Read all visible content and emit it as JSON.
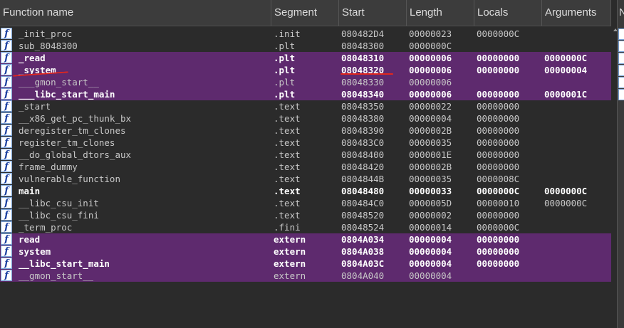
{
  "columns": [
    "Function name",
    "Segment",
    "Start",
    "Length",
    "Locals",
    "Arguments"
  ],
  "side_header": "N",
  "icon_glyph": "f",
  "highlight_color": "#5e2a6e",
  "annotation_color": "#e0261f",
  "rows": [
    {
      "name": "_init_proc",
      "segment": ".init",
      "start": "080482D4",
      "length": "00000023",
      "locals": "0000000C",
      "args": "",
      "highlight": false,
      "bold": false
    },
    {
      "name": "sub_8048300",
      "segment": ".plt",
      "start": "08048300",
      "length": "0000000C",
      "locals": "",
      "args": "",
      "highlight": false,
      "bold": false
    },
    {
      "name": "_read",
      "segment": ".plt",
      "start": "08048310",
      "length": "00000006",
      "locals": "00000000",
      "args": "0000000C",
      "highlight": true,
      "bold": true
    },
    {
      "name": "_system",
      "segment": ".plt",
      "start": "08048320",
      "length": "00000006",
      "locals": "00000000",
      "args": "00000004",
      "highlight": true,
      "bold": true
    },
    {
      "name": "___gmon_start__",
      "segment": ".plt",
      "start": "08048330",
      "length": "00000006",
      "locals": "",
      "args": "",
      "highlight": true,
      "bold": false
    },
    {
      "name": "___libc_start_main",
      "segment": ".plt",
      "start": "08048340",
      "length": "00000006",
      "locals": "00000000",
      "args": "0000001C",
      "highlight": true,
      "bold": true
    },
    {
      "name": "_start",
      "segment": ".text",
      "start": "08048350",
      "length": "00000022",
      "locals": "00000000",
      "args": "",
      "highlight": false,
      "bold": false
    },
    {
      "name": "__x86_get_pc_thunk_bx",
      "segment": ".text",
      "start": "08048380",
      "length": "00000004",
      "locals": "00000000",
      "args": "",
      "highlight": false,
      "bold": false
    },
    {
      "name": "deregister_tm_clones",
      "segment": ".text",
      "start": "08048390",
      "length": "0000002B",
      "locals": "00000000",
      "args": "",
      "highlight": false,
      "bold": false
    },
    {
      "name": "register_tm_clones",
      "segment": ".text",
      "start": "080483C0",
      "length": "00000035",
      "locals": "00000000",
      "args": "",
      "highlight": false,
      "bold": false
    },
    {
      "name": "__do_global_dtors_aux",
      "segment": ".text",
      "start": "08048400",
      "length": "0000001E",
      "locals": "00000000",
      "args": "",
      "highlight": false,
      "bold": false
    },
    {
      "name": "frame_dummy",
      "segment": ".text",
      "start": "08048420",
      "length": "0000002B",
      "locals": "00000000",
      "args": "",
      "highlight": false,
      "bold": false
    },
    {
      "name": "vulnerable_function",
      "segment": ".text",
      "start": "0804844B",
      "length": "00000035",
      "locals": "0000008C",
      "args": "",
      "highlight": false,
      "bold": false
    },
    {
      "name": "main",
      "segment": ".text",
      "start": "08048480",
      "length": "00000033",
      "locals": "0000000C",
      "args": "0000000C",
      "highlight": false,
      "bold": true
    },
    {
      "name": "__libc_csu_init",
      "segment": ".text",
      "start": "080484C0",
      "length": "0000005D",
      "locals": "00000010",
      "args": "0000000C",
      "highlight": false,
      "bold": false
    },
    {
      "name": "__libc_csu_fini",
      "segment": ".text",
      "start": "08048520",
      "length": "00000002",
      "locals": "00000000",
      "args": "",
      "highlight": false,
      "bold": false
    },
    {
      "name": "_term_proc",
      "segment": ".fini",
      "start": "08048524",
      "length": "00000014",
      "locals": "0000000C",
      "args": "",
      "highlight": false,
      "bold": false
    },
    {
      "name": "read",
      "segment": "extern",
      "start": "0804A034",
      "length": "00000004",
      "locals": "00000000",
      "args": "",
      "highlight": true,
      "bold": true
    },
    {
      "name": "system",
      "segment": "extern",
      "start": "0804A038",
      "length": "00000004",
      "locals": "00000000",
      "args": "",
      "highlight": true,
      "bold": true
    },
    {
      "name": "__libc_start_main",
      "segment": "extern",
      "start": "0804A03C",
      "length": "00000004",
      "locals": "00000000",
      "args": "",
      "highlight": true,
      "bold": true
    },
    {
      "name": "__gmon_start__",
      "segment": "extern",
      "start": "0804A040",
      "length": "00000004",
      "locals": "",
      "args": "",
      "highlight": true,
      "bold": false
    }
  ]
}
